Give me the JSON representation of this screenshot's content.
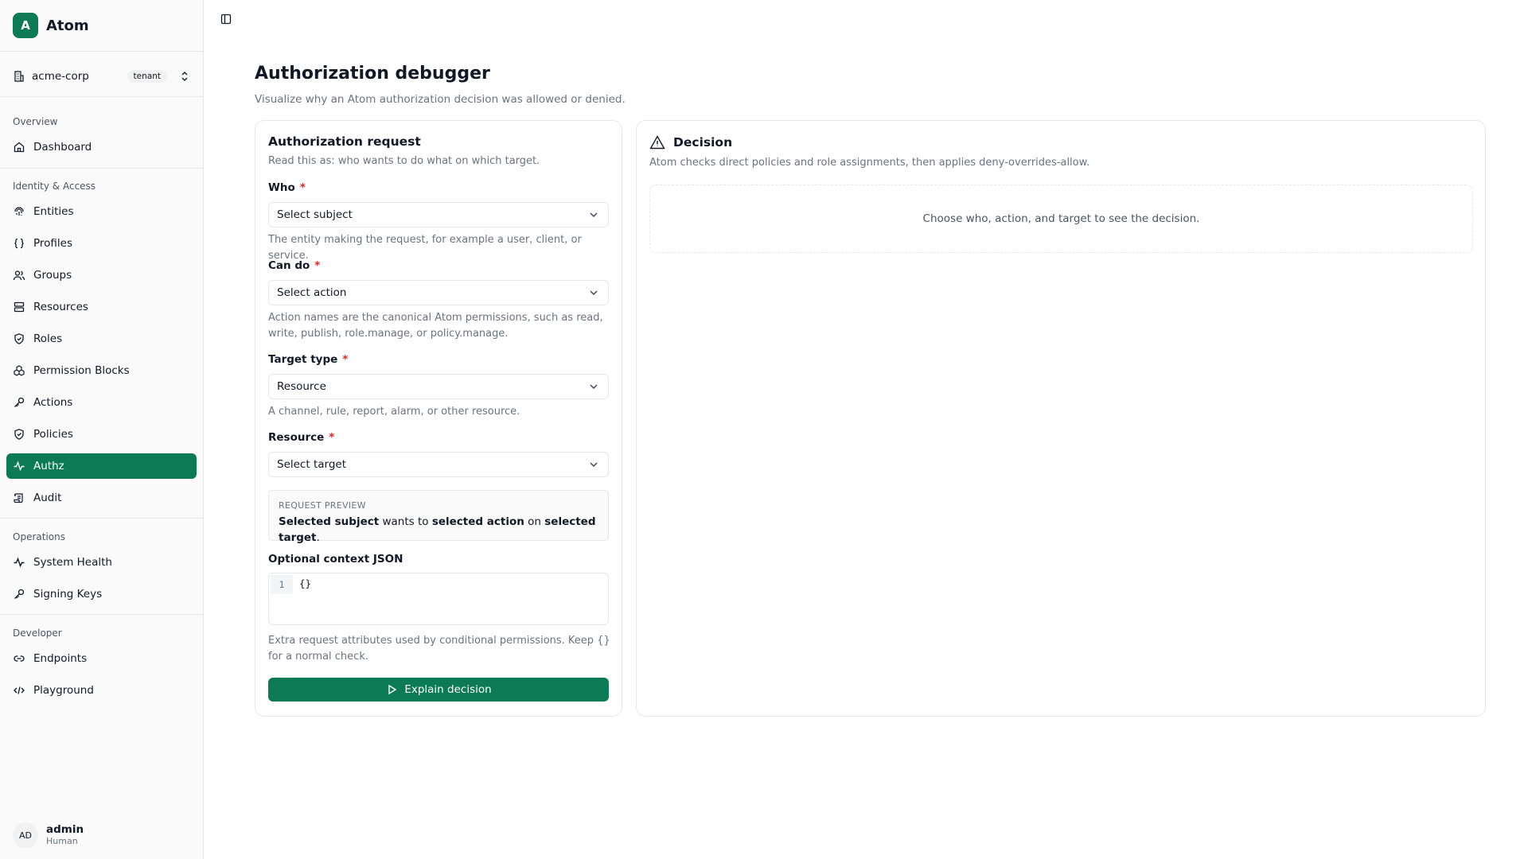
{
  "app": {
    "logo_letter": "A",
    "name": "Atom"
  },
  "tenant": {
    "name": "acme-corp",
    "badge": "tenant"
  },
  "sidebar": {
    "groups": [
      {
        "label": "Overview",
        "items": [
          {
            "label": "Dashboard",
            "icon": "home-icon"
          }
        ]
      },
      {
        "label": "Identity & Access",
        "items": [
          {
            "label": "Entities",
            "icon": "fingerprint-icon"
          },
          {
            "label": "Profiles",
            "icon": "braces-icon"
          },
          {
            "label": "Groups",
            "icon": "users-icon"
          },
          {
            "label": "Resources",
            "icon": "server-icon"
          },
          {
            "label": "Roles",
            "icon": "shield-icon"
          },
          {
            "label": "Permission Blocks",
            "icon": "blocks-icon"
          },
          {
            "label": "Actions",
            "icon": "key-icon"
          },
          {
            "label": "Policies",
            "icon": "shield-icon"
          },
          {
            "label": "Authz",
            "icon": "activity-icon",
            "active": true
          },
          {
            "label": "Audit",
            "icon": "scroll-icon"
          }
        ]
      },
      {
        "label": "Operations",
        "items": [
          {
            "label": "System Health",
            "icon": "activity-icon"
          },
          {
            "label": "Signing Keys",
            "icon": "key-icon"
          }
        ]
      },
      {
        "label": "Developer",
        "items": [
          {
            "label": "Endpoints",
            "icon": "link-icon"
          },
          {
            "label": "Playground",
            "icon": "code-icon"
          }
        ]
      }
    ]
  },
  "user": {
    "initials": "AD",
    "name": "admin",
    "role": "Human"
  },
  "page": {
    "title": "Authorization debugger",
    "subtitle": "Visualize why an Atom authorization decision was allowed or denied."
  },
  "request": {
    "title": "Authorization request",
    "description": "Read this as: who wants to do what on which target.",
    "who": {
      "label": "Who",
      "required": "*",
      "value": "Select subject",
      "help": "The entity making the request, for example a user, client, or service."
    },
    "can_do": {
      "label": "Can do",
      "required": "*",
      "value": "Select action",
      "help": "Action names are the canonical Atom permissions, such as read, write, publish, role.manage, or policy.manage."
    },
    "target_type": {
      "label": "Target type",
      "required": "*",
      "value": "Resource",
      "help": "A channel, rule, report, alarm, or other resource."
    },
    "resource": {
      "label": "Resource",
      "required": "*",
      "value": "Select target"
    },
    "preview": {
      "label": "REQUEST PREVIEW",
      "subject": "Selected subject",
      "text1": " wants to ",
      "action": "selected action",
      "text2": " on ",
      "target": "selected target",
      "end": "."
    },
    "context": {
      "label": "Optional context JSON",
      "line_number": "1",
      "value": "{}",
      "help": "Extra request attributes used by conditional permissions. Keep {} for a normal check."
    },
    "explain_button": "Explain decision"
  },
  "decision": {
    "title": "Decision",
    "description": "Atom checks direct policies and role assignments, then applies deny-overrides-allow.",
    "empty_message": "Choose who, action, and target to see the decision."
  },
  "colors": {
    "accent": "#0b7a55",
    "required": "#dc2626",
    "border": "#e5e7eb"
  }
}
